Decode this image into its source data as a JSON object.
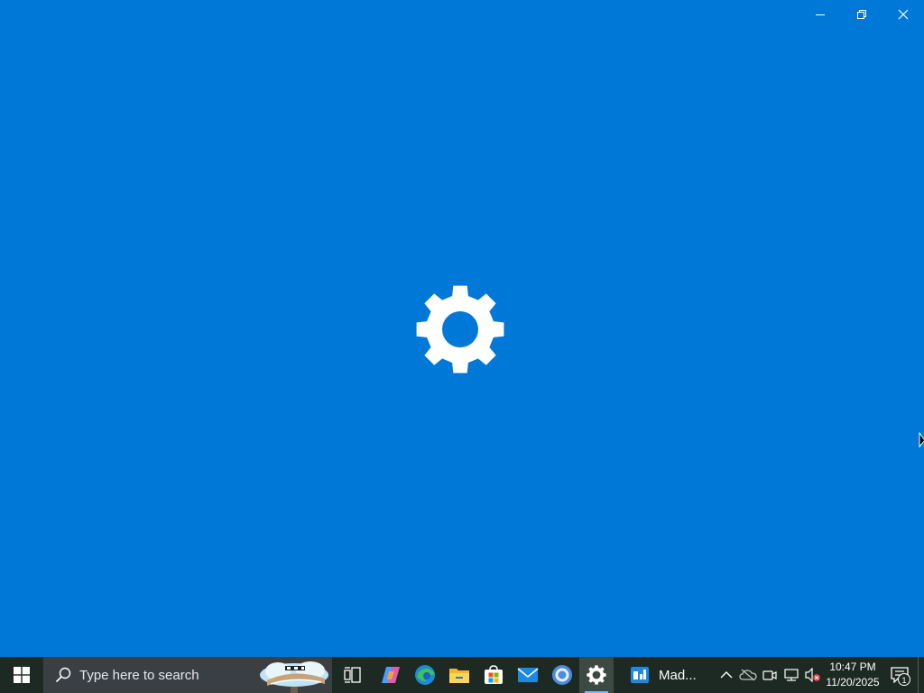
{
  "window": {
    "caption_buttons": [
      {
        "name": "minimize",
        "icon": "minimize-icon"
      },
      {
        "name": "restore",
        "icon": "restore-icon"
      },
      {
        "name": "close",
        "icon": "close-icon"
      }
    ],
    "splash_icon": "settings-gear-icon",
    "background_color": "#0078d7"
  },
  "taskbar": {
    "background_color": "#1c2a23",
    "search": {
      "placeholder": "Type here to search",
      "icon": "search-icon"
    },
    "apps": [
      {
        "name": "task-view",
        "icon": "task-view-icon"
      },
      {
        "name": "copilot",
        "icon": "copilot-icon"
      },
      {
        "name": "edge",
        "icon": "edge-icon"
      },
      {
        "name": "file-explorer",
        "icon": "folder-icon"
      },
      {
        "name": "microsoft-store",
        "icon": "store-icon"
      },
      {
        "name": "mail",
        "icon": "mail-icon"
      },
      {
        "name": "chrome",
        "icon": "chrome-icon"
      },
      {
        "name": "settings",
        "icon": "gear-icon",
        "active": true
      }
    ],
    "running_window": {
      "label": "Mad...",
      "icon": "app-window-icon"
    },
    "tray": {
      "icons": [
        "chevron-up-icon",
        "onedrive-icon",
        "meet-now-icon",
        "network-icon",
        "volume-muted-icon"
      ],
      "time": "10:47 PM",
      "date": "11/20/2025",
      "notification_count": "1"
    }
  }
}
